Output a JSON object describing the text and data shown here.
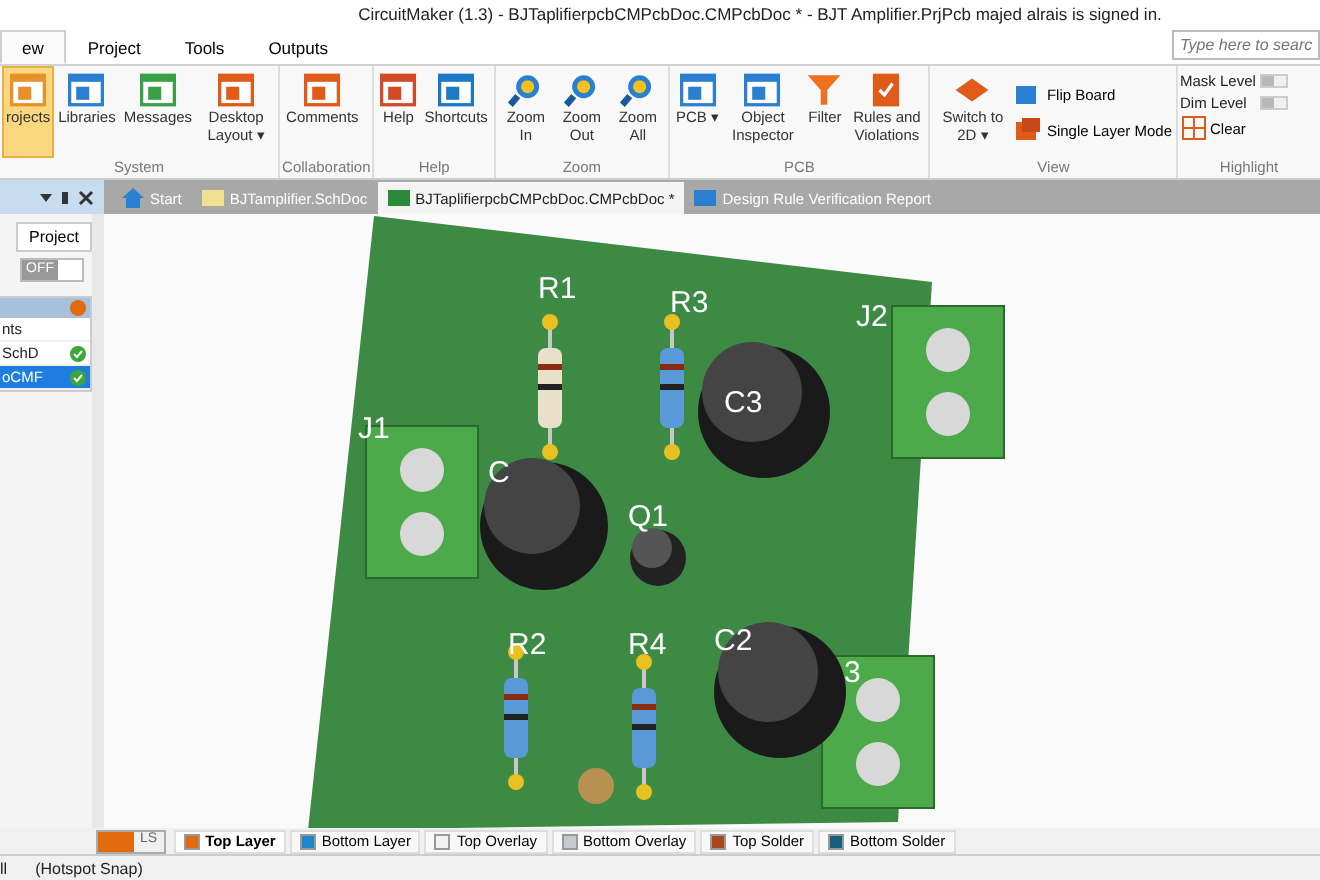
{
  "window": {
    "title": "CircuitMaker (1.3) - BJTaplifierpcbCMPcbDoc.CMPcbDoc * - BJT Amplifier.PrjPcb majed alrais is signed in."
  },
  "menu_tabs": [
    {
      "label": "ew",
      "selected": true
    },
    {
      "label": "Project",
      "selected": false
    },
    {
      "label": "Tools",
      "selected": false
    },
    {
      "label": "Outputs",
      "selected": false
    }
  ],
  "search": {
    "placeholder": "Type here to searc"
  },
  "ribbon_groups": [
    {
      "name": "System",
      "buttons": [
        {
          "kind": "projects",
          "label": "rojects",
          "active": true
        },
        {
          "kind": "libraries",
          "label": "Libraries",
          "active": false
        },
        {
          "kind": "messages",
          "label": "Messages",
          "active": false
        },
        {
          "kind": "layout",
          "label": "Desktop Layout ▾",
          "active": false
        }
      ]
    },
    {
      "name": "Collaboration",
      "buttons": [
        {
          "kind": "comments",
          "label": "Comments",
          "active": false
        }
      ]
    },
    {
      "name": "Help",
      "buttons": [
        {
          "kind": "help",
          "label": "Help",
          "active": false
        },
        {
          "kind": "shortcuts",
          "label": "Shortcuts",
          "active": false
        }
      ]
    },
    {
      "name": "Zoom",
      "buttons": [
        {
          "kind": "zoomin",
          "label": "Zoom In",
          "active": false
        },
        {
          "kind": "zoomout",
          "label": "Zoom Out",
          "active": false
        },
        {
          "kind": "zoomall",
          "label": "Zoom All",
          "active": false
        }
      ]
    },
    {
      "name": "PCB",
      "buttons": [
        {
          "kind": "pcb",
          "label": "PCB ▾",
          "active": false
        },
        {
          "kind": "inspector",
          "label": "Object Inspector",
          "active": false
        },
        {
          "kind": "filter",
          "label": "Filter",
          "active": false
        },
        {
          "kind": "rules",
          "label": "Rules and Violations",
          "active": false
        }
      ]
    },
    {
      "name": "View",
      "buttons": [
        {
          "kind": "switch2d",
          "label": "Switch to 2D ▾",
          "active": false
        }
      ],
      "small_buttons": [
        {
          "kind": "flip",
          "label": "Flip Board"
        },
        {
          "kind": "single",
          "label": "Single Layer Mode"
        }
      ]
    }
  ],
  "highlight": {
    "name": "Highlight",
    "mask": {
      "label": "Mask Level",
      "level": 0.5
    },
    "dim": {
      "label": "Dim Level",
      "level": 0.5
    },
    "clear_label": "Clear"
  },
  "doc_tabs": [
    {
      "kind": "home",
      "label": "Start",
      "selected": false
    },
    {
      "kind": "sch",
      "label": "BJTamplifier.SchDoc",
      "selected": false
    },
    {
      "kind": "pcb",
      "label": "BJTaplifierpcbCMPcbDoc.CMPcbDoc *",
      "selected": true
    },
    {
      "kind": "report",
      "label": "Design Rule Verification Report",
      "selected": false
    }
  ],
  "left_panel": {
    "project_button": "Project",
    "toggle": {
      "label": "OFF",
      "on": false
    },
    "rows": [
      {
        "name": "nts",
        "selected": false,
        "status": false
      },
      {
        "name": "SchD",
        "selected": false,
        "status": true
      },
      {
        "name": "oCMF",
        "selected": true,
        "status": true
      }
    ]
  },
  "board_labels": [
    "R1",
    "R3",
    "J2",
    "C3",
    "J1",
    "C",
    "Q1",
    "R2",
    "R4",
    "C2",
    "3"
  ],
  "layer_tabs": [
    {
      "label": "Top Layer",
      "color": "#e06a10",
      "selected": true
    },
    {
      "label": "Bottom Layer",
      "color": "#1f86c8",
      "selected": false
    },
    {
      "label": "Top Overlay",
      "color": "#f2f2f2",
      "selected": false
    },
    {
      "label": "Bottom Overlay",
      "color": "#c8c8d2",
      "selected": false
    },
    {
      "label": "Top Solder",
      "color": "#a8461c",
      "selected": false
    },
    {
      "label": "Bottom Solder",
      "color": "#17607a",
      "selected": false
    }
  ],
  "layer_set": "LS",
  "status_bar": [
    "ll",
    "(Hotspot Snap)"
  ]
}
